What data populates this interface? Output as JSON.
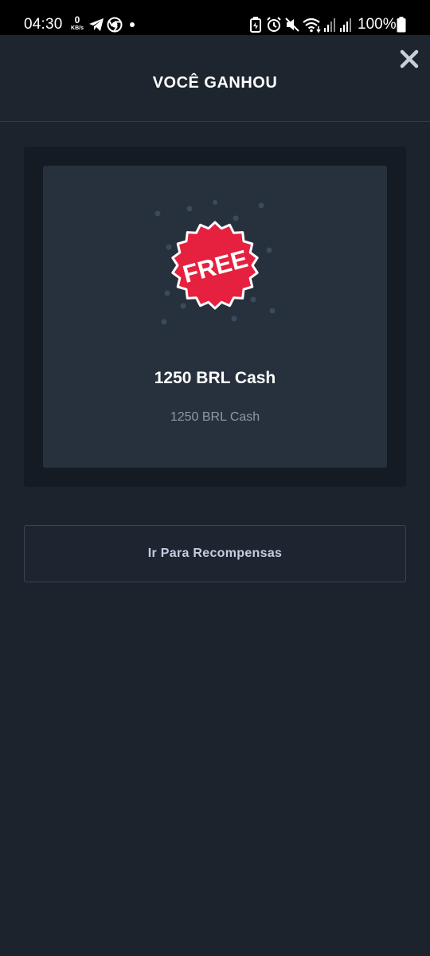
{
  "status_bar": {
    "time": "04:30",
    "net_speed_value": "0",
    "net_speed_unit": "KB/s",
    "battery_percent": "100%",
    "icons": [
      "telegram-icon",
      "chrome-icon",
      "dot-icon",
      "battery-saver-icon",
      "alarm-icon",
      "mute-icon",
      "wifi-icon",
      "signal-icon",
      "signal-icon",
      "battery-icon"
    ]
  },
  "header": {
    "title": "VOCÊ GANHOU",
    "close_icon": "close-icon"
  },
  "reward": {
    "badge_text": "FREE",
    "badge_color": "#e5213f",
    "name": "1250 BRL Cash",
    "description": "1250 BRL Cash"
  },
  "actions": {
    "go_to_rewards_label": "Ir Para Recompensas"
  }
}
